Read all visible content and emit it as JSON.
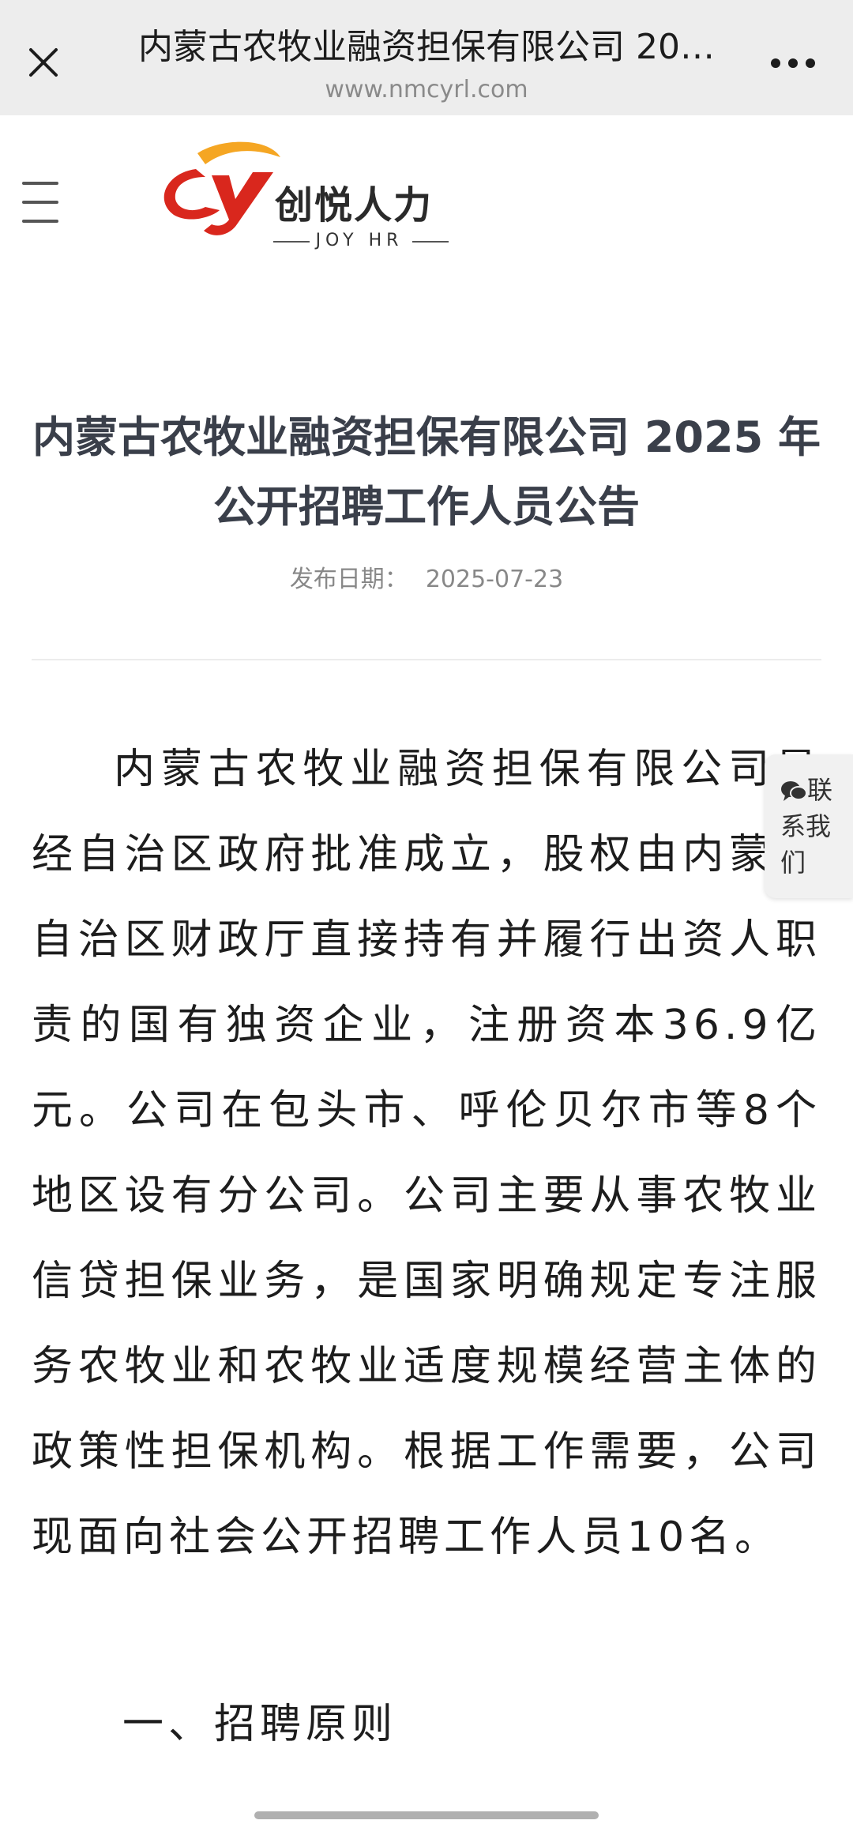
{
  "browser": {
    "title": "内蒙古农牧业融资担保有限公司 20…",
    "url": "www.nmcyrl.com"
  },
  "site": {
    "logo_cn": "创悦人力",
    "logo_en": "JOY HR"
  },
  "article": {
    "title": "内蒙古农牧业融资担保有限公司 2025 年公开招聘工作人员公告",
    "date_label": "发布日期：",
    "date": "2025-07-23",
    "body": "内蒙古农牧业融资担保有限公司是经自治区政府批准成立，股权由内蒙古自治区财政厅直接持有并履行出资人职责的国有独资企业，注册资本36.9亿元。公司在包头市、呼伦贝尔市等8个地区设有分公司。公司主要从事农牧业信贷担保业务，是国家明确规定专注服务农牧业和农牧业适度规模经营主体的政策性担保机构。根据工作需要，公司现面向社会公开招聘工作人员10名。",
    "section_1": "一、招聘原则"
  },
  "contact": {
    "label": "联系我们"
  },
  "colors": {
    "topbar_bg": "#ededed",
    "title_color": "#3a3f4a",
    "logo_red": "#d9271d",
    "logo_orange": "#f5a623"
  }
}
